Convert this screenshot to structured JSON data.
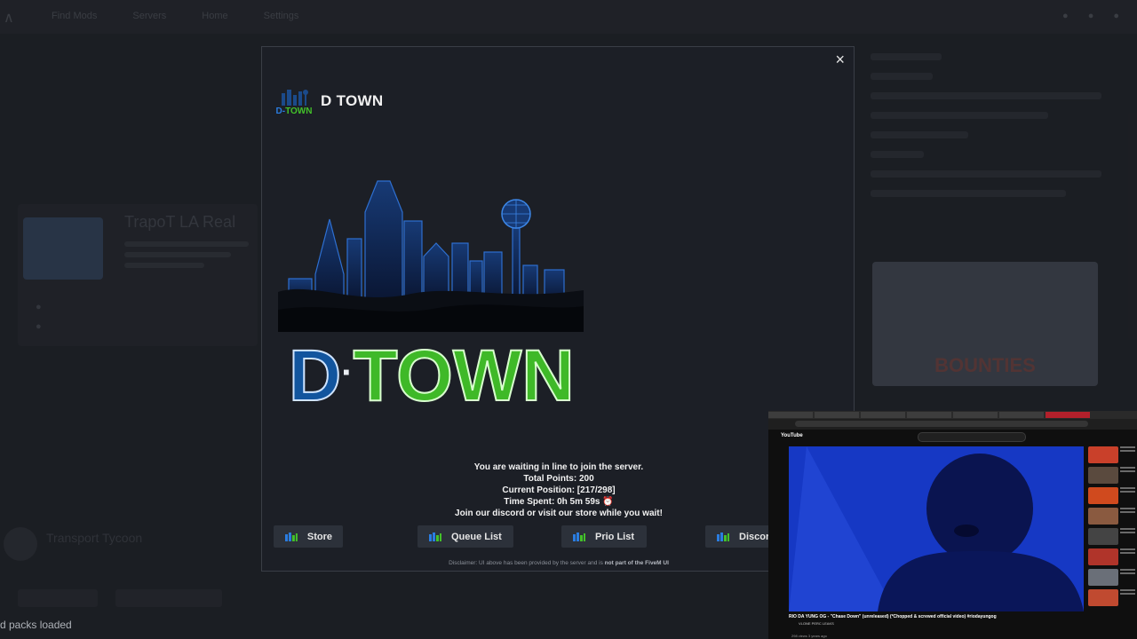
{
  "background": {
    "nav": [
      "Find Mods",
      "Servers",
      "Home",
      "Settings"
    ],
    "server_title": "TrapoT LA Real",
    "transport_title": "Transport Tycoon",
    "bounties_text": "BOUNTIES",
    "status_text": "d packs loaded"
  },
  "modal": {
    "close_symbol": "×",
    "brand_name": "D TOWN",
    "logo_text": "D·TOWN",
    "logo_small_text": "D-TOWN",
    "queue": {
      "line1": "You are waiting in line to join the server.",
      "line2": "Total Points: 200",
      "line3": "Current Position: [217/298]",
      "line4": "Time Spent: 0h 5m 59s ⏰",
      "line5": "Join our discord or visit our store while you wait!"
    },
    "buttons": [
      "Store",
      "Queue List",
      "Prio List",
      "Discord"
    ],
    "disclaimer_prefix": "Disclaimer: UI above has been provided by the server and is ",
    "disclaimer_bold": "not part of the FiveM UI"
  },
  "video_overlay": {
    "yt_logo": "YouTube",
    "title": "RIO DA YUNG OG - \"Chase Down\" (unreleased) (*Chopped & screwed official video) #riodayungog",
    "channel": "VLONE PERC LEAKS",
    "views": "298 views 3 years ago"
  },
  "colors": {
    "accent_green": "#3fb928",
    "accent_blue": "#1e6fc6",
    "modal_bg": "#1c1f26"
  }
}
